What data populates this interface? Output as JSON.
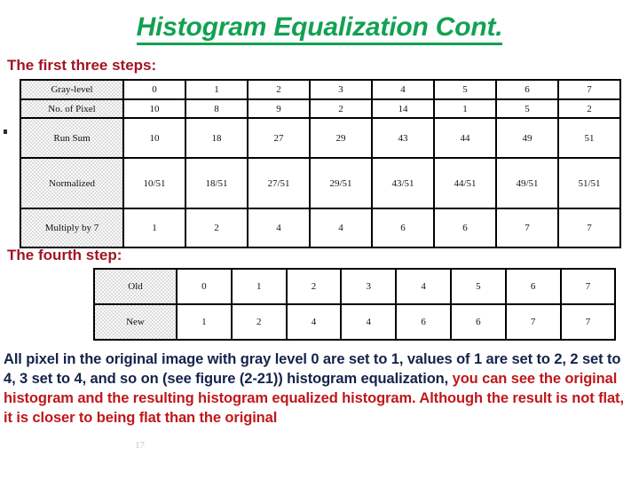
{
  "slide": {
    "title": "Histogram Equalization Cont.",
    "title_color": "#12a152",
    "heading_color": "#a11423",
    "body_color": "#14234a",
    "accent_red": "#c0171b",
    "page_number": "17"
  },
  "headings": {
    "first_steps": "The first three steps:",
    "fourth_step": "The fourth step:"
  },
  "steps_table": {
    "row_labels": [
      "Gray-level",
      "No. of Pixel",
      "Run Sum",
      "Normalized",
      "Multiply by 7"
    ],
    "rows": [
      {
        "label": "Gray-level",
        "values": [
          "0",
          "1",
          "2",
          "3",
          "4",
          "5",
          "6",
          "7"
        ]
      },
      {
        "label": "No. of Pixel",
        "values": [
          "10",
          "8",
          "9",
          "2",
          "14",
          "1",
          "5",
          "2"
        ]
      },
      {
        "label": "Run Sum",
        "values": [
          "10",
          "18",
          "27",
          "29",
          "43",
          "44",
          "49",
          "51"
        ]
      },
      {
        "label": "Normalized",
        "values": [
          "10/51",
          "18/51",
          "27/51",
          "29/51",
          "43/51",
          "44/51",
          "49/51",
          "51/51"
        ]
      },
      {
        "label": "Multiply by 7",
        "values": [
          "1",
          "2",
          "4",
          "4",
          "6",
          "6",
          "7",
          "7"
        ]
      }
    ]
  },
  "mapping_table": {
    "rows": [
      {
        "label": "Old",
        "values": [
          "0",
          "1",
          "2",
          "3",
          "4",
          "5",
          "6",
          "7"
        ]
      },
      {
        "label": "New",
        "values": [
          "1",
          "2",
          "4",
          "4",
          "6",
          "6",
          "7",
          "7"
        ]
      }
    ]
  },
  "paragraph": {
    "part1": "All pixel in the original image with gray level 0 are set to 1, values of 1 are set to 2, 2 set to 4, 3 set to 4, and so on (see figure (2-21)) histogram equalization,",
    "part2": " you can see the original histogram and the resulting histogram equalized histogram. Although the result is not flat, it is closer to being flat than the original"
  }
}
